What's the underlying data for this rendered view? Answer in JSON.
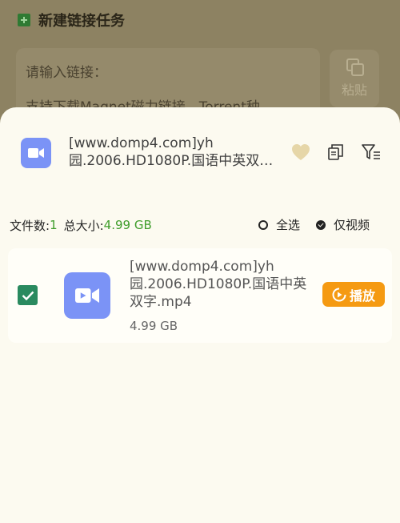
{
  "background": {
    "title": "新建链接任务",
    "input_placeholder": "请输入链接：",
    "input_hint": "支持下载Magnet磁力链接，Torrent种",
    "paste_label": "粘贴"
  },
  "sheet": {
    "task_name_line1": "[www.domp4.com]yh",
    "task_name_line2": "园.2006.HD1080P.国语中英双…",
    "icons": [
      "video-camera-icon",
      "heart-icon",
      "copy-icon",
      "filter-icon"
    ],
    "summary": {
      "file_count_label": "文件数:",
      "file_count": "1",
      "total_size_label": "总大小:",
      "total_size": "4.99 GB"
    },
    "options": {
      "select_all": "全选",
      "video_only": "仅视频"
    },
    "files": [
      {
        "name": "[www.domp4.com]yh园.2006.HD1080P.国语中英双字.mp4",
        "size": "4.99 GB",
        "checked": true,
        "play_label": "播放"
      }
    ]
  },
  "colors": {
    "accent_green": "#3f9d2b",
    "video_icon": "#7b93f6",
    "play_button": "#f59a12",
    "checkbox": "#2a8a5f"
  }
}
